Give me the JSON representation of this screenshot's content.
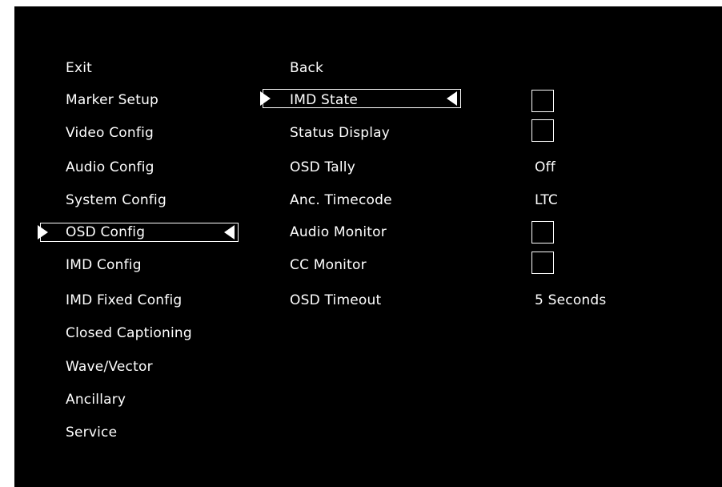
{
  "main_menu": {
    "items": [
      {
        "label": "Exit"
      },
      {
        "label": "Marker Setup"
      },
      {
        "label": "Video Config"
      },
      {
        "label": "Audio Config"
      },
      {
        "label": "System Config"
      },
      {
        "label": "OSD Config",
        "selected": true
      },
      {
        "label": "IMD Config"
      },
      {
        "label": "IMD Fixed Config"
      },
      {
        "label": "Closed Captioning"
      },
      {
        "label": "Wave/Vector"
      },
      {
        "label": "Ancillary"
      },
      {
        "label": "Service"
      }
    ]
  },
  "submenu": {
    "items": [
      {
        "label": "Back",
        "value": ""
      },
      {
        "label": "IMD State",
        "value": "",
        "control": "checkbox",
        "checked": false,
        "selected": true
      },
      {
        "label": "Status Display",
        "value": "",
        "control": "checkbox",
        "checked": false
      },
      {
        "label": "OSD Tally",
        "value": "Off"
      },
      {
        "label": "Anc. Timecode",
        "value": "LTC"
      },
      {
        "label": "Audio Monitor",
        "value": "",
        "control": "checkbox",
        "checked": false
      },
      {
        "label": "CC Monitor",
        "value": "",
        "control": "checkbox",
        "checked": false
      },
      {
        "label": "OSD Timeout",
        "value": "5 Seconds"
      }
    ]
  },
  "colors": {
    "background": "#000000",
    "foreground": "#ffffff"
  }
}
